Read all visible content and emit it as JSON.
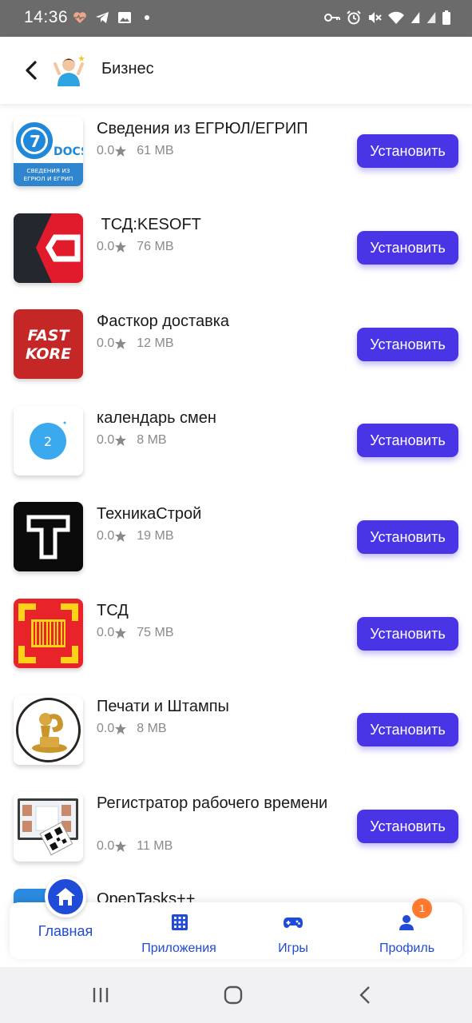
{
  "status_bar": {
    "time": "14:36",
    "left_icons": [
      "heart-pulse-icon",
      "telegram-icon",
      "gallery-icon",
      "dot-icon"
    ],
    "right_icons": [
      "vpn-key-icon",
      "alarm-icon",
      "mute-icon",
      "wifi-icon",
      "signal-icon",
      "signal-icon",
      "battery-icon"
    ]
  },
  "header": {
    "back_icon": "arrow-back-icon",
    "title": "Бизнес"
  },
  "install_label": "Установить",
  "apps": [
    {
      "name": "Сведения из ЕГРЮЛ/ЕГРИП",
      "rating": "0.0",
      "size": "61 MB",
      "icon": "docs-icon",
      "icon_text": "DOCS",
      "icon_subtext": "СВЕДЕНИЯ ИЗ ЕГРЮЛ И ЕГРИП"
    },
    {
      "name": " ТСД:KESOFT",
      "rating": "0.0",
      "size": "76 MB",
      "icon": "kesoft-icon"
    },
    {
      "name": "Фасткор доставка",
      "rating": "0.0",
      "size": "12 MB",
      "icon": "fastkore-icon",
      "icon_text": "FAST",
      "icon_subtext": "KORE"
    },
    {
      "name": "календарь смен",
      "rating": "0.0",
      "size": "8 MB",
      "icon": "calendar-icon",
      "icon_text": "2"
    },
    {
      "name": "ТехникаСтрой",
      "rating": "0.0",
      "size": "19 MB",
      "icon": "t-letter-icon"
    },
    {
      "name": "ТСД",
      "rating": "0.0",
      "size": "75 MB",
      "icon": "barcode-scanner-icon"
    },
    {
      "name": "Печати и Штампы",
      "rating": "0.0",
      "size": "8 MB",
      "icon": "stamp-icon"
    },
    {
      "name": "Регистратор рабочего времени",
      "rating": "0.0",
      "size": "11 MB",
      "icon": "time-tracker-icon"
    },
    {
      "name": "OpenTasks++",
      "icon": "opentasks-icon"
    }
  ],
  "bottom_nav": {
    "items": [
      {
        "label": "Главная",
        "icon": "home-icon",
        "active": true
      },
      {
        "label": "Приложения",
        "icon": "apps-grid-icon"
      },
      {
        "label": "Игры",
        "icon": "gamepad-icon"
      },
      {
        "label": "Профиль",
        "icon": "user-icon",
        "badge": "1"
      }
    ]
  },
  "colors": {
    "accent": "#4a35e6",
    "nav_blue": "#1f4bd8",
    "badge": "#ff7a2f"
  }
}
